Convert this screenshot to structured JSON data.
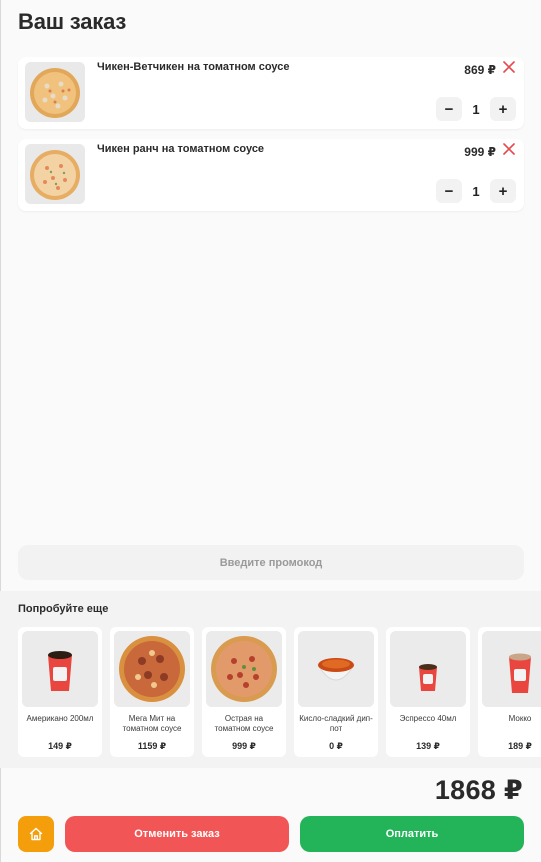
{
  "header": {
    "title": "Ваш заказ"
  },
  "cart": {
    "items": [
      {
        "name": "Чикен-Ветчикен на томатном соусе",
        "price": "869 ₽",
        "quantity": "1",
        "minus_label": "−",
        "plus_label": "+",
        "image_icon": "pizza-icon"
      },
      {
        "name": "Чикен ранч на томатном соусе",
        "price": "999 ₽",
        "quantity": "1",
        "minus_label": "−",
        "plus_label": "+",
        "image_icon": "pizza-icon"
      }
    ],
    "remove_icon": "close-icon",
    "remove_color": "#e5484d"
  },
  "promo": {
    "placeholder": "Введите промокод"
  },
  "upsell": {
    "title": "Попробуйте еще",
    "items": [
      {
        "name": "Американо 200мл",
        "price": "149 ₽",
        "image_icon": "coffee-cup-icon"
      },
      {
        "name": "Мега Мит на томатном соусе",
        "price": "1159 ₽",
        "image_icon": "pizza-icon"
      },
      {
        "name": "Острая на томатном соусе",
        "price": "999 ₽",
        "image_icon": "pizza-icon"
      },
      {
        "name": "Кисло-сладкий дип-пот",
        "price": "0 ₽",
        "image_icon": "sauce-icon"
      },
      {
        "name": "Эспрессо 40мл",
        "price": "139 ₽",
        "image_icon": "coffee-cup-icon"
      },
      {
        "name": "Мокко",
        "price": "189 ₽",
        "image_icon": "coffee-cup-icon"
      }
    ]
  },
  "footer": {
    "total": "1868 ₽",
    "home_icon": "home-icon",
    "cancel_label": "Отменить заказ",
    "pay_label": "Оплатить",
    "colors": {
      "home": "#f59e0b",
      "cancel": "#f25555",
      "pay": "#23b45a"
    }
  }
}
